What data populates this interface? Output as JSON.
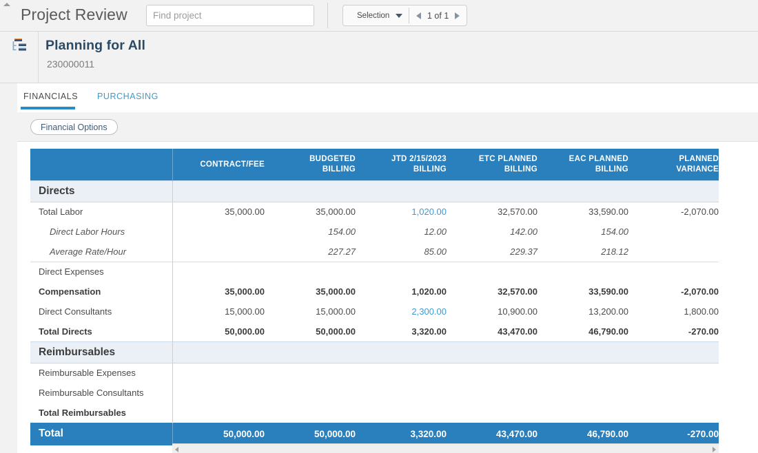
{
  "topbar": {
    "title": "Project Review",
    "search": {
      "value": "",
      "placeholder": "Find project"
    },
    "selection": {
      "label": "Selection",
      "icon": "filter-funnel-icon"
    },
    "pager": {
      "text": "1 of 1",
      "prev_icon": "triangle-left-icon",
      "next_icon": "triangle-right-icon"
    }
  },
  "project": {
    "icon": "org-hierarchy-icon",
    "name": "Planning for All",
    "number": "230000011"
  },
  "tabs": [
    {
      "label": "FINANCIALS",
      "active": true
    },
    {
      "label": "PURCHASING",
      "active": false
    }
  ],
  "options": {
    "financial_options_label": "Financial Options"
  },
  "colors": {
    "header_blue": "#2a80bd",
    "link_blue": "#3d9ad1",
    "section_row": "#ebf0f7",
    "title_navy": "#2b4a66"
  },
  "table": {
    "columns": [
      {
        "id": "label",
        "lines": [
          ""
        ]
      },
      {
        "id": "contract_fee",
        "lines": [
          "CONTRACT/FEE"
        ]
      },
      {
        "id": "budgeted_billing",
        "lines": [
          "BUDGETED",
          "BILLING"
        ]
      },
      {
        "id": "jtd_billing",
        "lines": [
          "JTD 2/15/2023",
          "BILLING"
        ]
      },
      {
        "id": "etc_planned_billing",
        "lines": [
          "ETC PLANNED",
          "BILLING"
        ]
      },
      {
        "id": "eac_planned_billing",
        "lines": [
          "EAC PLANNED",
          "BILLING"
        ]
      },
      {
        "id": "planned_variance",
        "lines": [
          "PLANNED",
          "VARIANCE"
        ]
      }
    ],
    "rows": [
      {
        "type": "section",
        "label": "Directs",
        "cells": [
          "",
          "",
          "",
          "",
          "",
          ""
        ]
      },
      {
        "type": "normal",
        "label": "Total Labor",
        "cells": [
          "35,000.00",
          "35,000.00",
          "1,020.00",
          "32,570.00",
          "33,590.00",
          "-2,070.00"
        ],
        "link_cols": [
          2
        ]
      },
      {
        "type": "italic",
        "label": "Direct Labor Hours",
        "cells": [
          "",
          "154.00",
          "12.00",
          "142.00",
          "154.00",
          ""
        ],
        "link_cols": [
          2
        ]
      },
      {
        "type": "italic",
        "label": "Average Rate/Hour",
        "cells": [
          "",
          "227.27",
          "85.00",
          "229.37",
          "218.12",
          ""
        ],
        "link_cols": []
      },
      {
        "type": "normal",
        "label": "Direct Expenses",
        "cells": [
          "",
          "",
          "",
          "",
          "",
          ""
        ],
        "link_cols": [],
        "sep_top": true
      },
      {
        "type": "bold",
        "label": "Compensation",
        "cells": [
          "35,000.00",
          "35,000.00",
          "1,020.00",
          "32,570.00",
          "33,590.00",
          "-2,070.00"
        ],
        "link_cols": []
      },
      {
        "type": "normal",
        "label": "Direct Consultants",
        "cells": [
          "15,000.00",
          "15,000.00",
          "2,300.00",
          "10,900.00",
          "13,200.00",
          "1,800.00"
        ],
        "link_cols": [
          2
        ]
      },
      {
        "type": "bold",
        "label": "Total Directs",
        "cells": [
          "50,000.00",
          "50,000.00",
          "3,320.00",
          "43,470.00",
          "46,790.00",
          "-270.00"
        ],
        "link_cols": []
      },
      {
        "type": "section",
        "label": "Reimbursables",
        "cells": [
          "",
          "",
          "",
          "",
          "",
          ""
        ]
      },
      {
        "type": "normal",
        "label": "Reimbursable Expenses",
        "cells": [
          "",
          "",
          "",
          "",
          "",
          ""
        ],
        "link_cols": []
      },
      {
        "type": "normal",
        "label": "Reimbursable Consultants",
        "cells": [
          "",
          "",
          "",
          "",
          "",
          ""
        ],
        "link_cols": []
      },
      {
        "type": "bold",
        "label": "Total Reimbursables",
        "cells": [
          "",
          "",
          "",
          "",
          "",
          ""
        ],
        "link_cols": []
      },
      {
        "type": "total",
        "label": "Total",
        "cells": [
          "50,000.00",
          "50,000.00",
          "3,320.00",
          "43,470.00",
          "46,790.00",
          "-270.00"
        ],
        "link_cols": []
      }
    ]
  },
  "scrollbar": {
    "left_arrow": "scroll-left-icon",
    "right_arrow": "scroll-right-icon"
  }
}
